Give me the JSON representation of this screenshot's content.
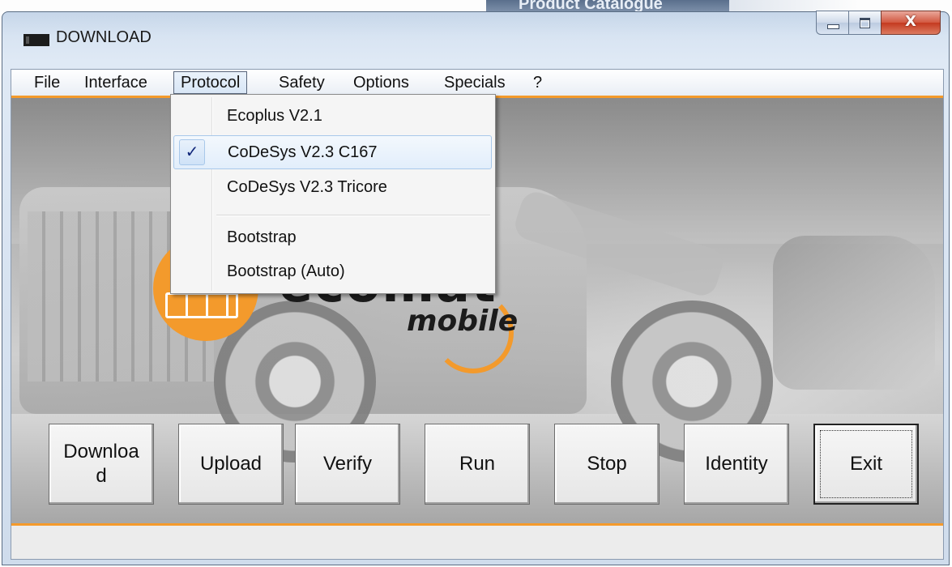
{
  "background": {
    "banner_text": "Product Catalogue"
  },
  "window": {
    "title": "DOWNLOAD",
    "close_glyph": "X"
  },
  "menubar": {
    "items": [
      {
        "label": "File"
      },
      {
        "label": "Interface"
      },
      {
        "label": "Protocol"
      },
      {
        "label": "Safety"
      },
      {
        "label": "Options"
      },
      {
        "label": "Specials"
      },
      {
        "label": "?"
      }
    ],
    "active": "Protocol"
  },
  "protocol_menu": {
    "items": [
      {
        "label": "Ecoplus V2.1",
        "checked": false
      },
      {
        "label": "CoDeSys V2.3 C167",
        "checked": true
      },
      {
        "label": "CoDeSys V2.3 Tricore",
        "checked": false
      },
      {
        "label": "Bootstrap",
        "checked": false
      },
      {
        "label": "Bootstrap (Auto)",
        "checked": false
      }
    ],
    "check_glyph": "✓"
  },
  "logo": {
    "mobile_text": "mobile"
  },
  "buttons": [
    {
      "label": "Download"
    },
    {
      "label": "Upload"
    },
    {
      "label": "Verify"
    },
    {
      "label": "Run"
    },
    {
      "label": "Stop"
    },
    {
      "label": "Identity"
    },
    {
      "label": "Exit"
    }
  ],
  "colors": {
    "accent_orange": "#f49a2b",
    "check_blue": "#12287a",
    "close_red": "#c4391f"
  }
}
